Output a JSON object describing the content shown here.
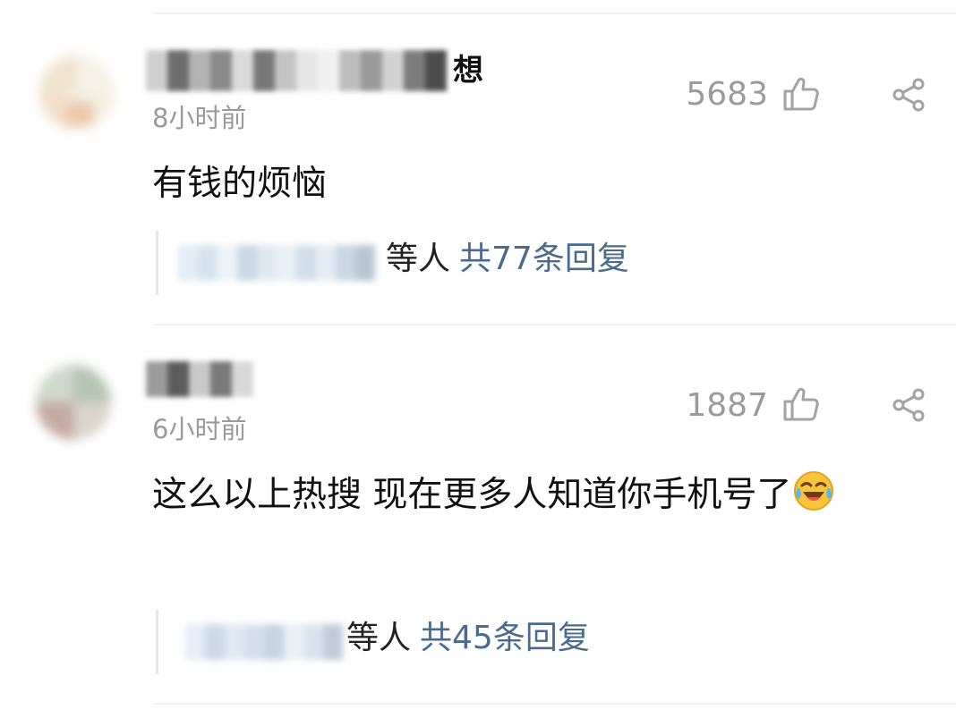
{
  "comments": [
    {
      "username_tail": "想",
      "time": "8小时前",
      "likes": "5683",
      "text": "有钱的烦恼",
      "emoji": "",
      "reply_who": "等人",
      "reply_count": "共77条回复",
      "avatar_colors": [
        "#f4efe3",
        "#efe3cc",
        "#f6f1e6",
        "#e9c8a8",
        "#f3dfc9"
      ]
    },
    {
      "username_tail": "",
      "time": "6小时前",
      "likes": "1887",
      "text": "这么以上热搜 现在更多人知道你手机号了",
      "emoji": "laughing-tears-icon",
      "reply_who": "等人",
      "reply_count": "共45条回复",
      "avatar_colors": [
        "#cfd8cc",
        "#b6c4b4",
        "#d9d4cc",
        "#c6a9a3",
        "#e0e6df"
      ]
    }
  ],
  "icons": {
    "like": "thumbs-up-outline-icon",
    "share": "share-icon"
  },
  "colors": {
    "reply_link": "#4a6a8e",
    "meta_gray": "#9a9a9a",
    "text": "#111111"
  }
}
